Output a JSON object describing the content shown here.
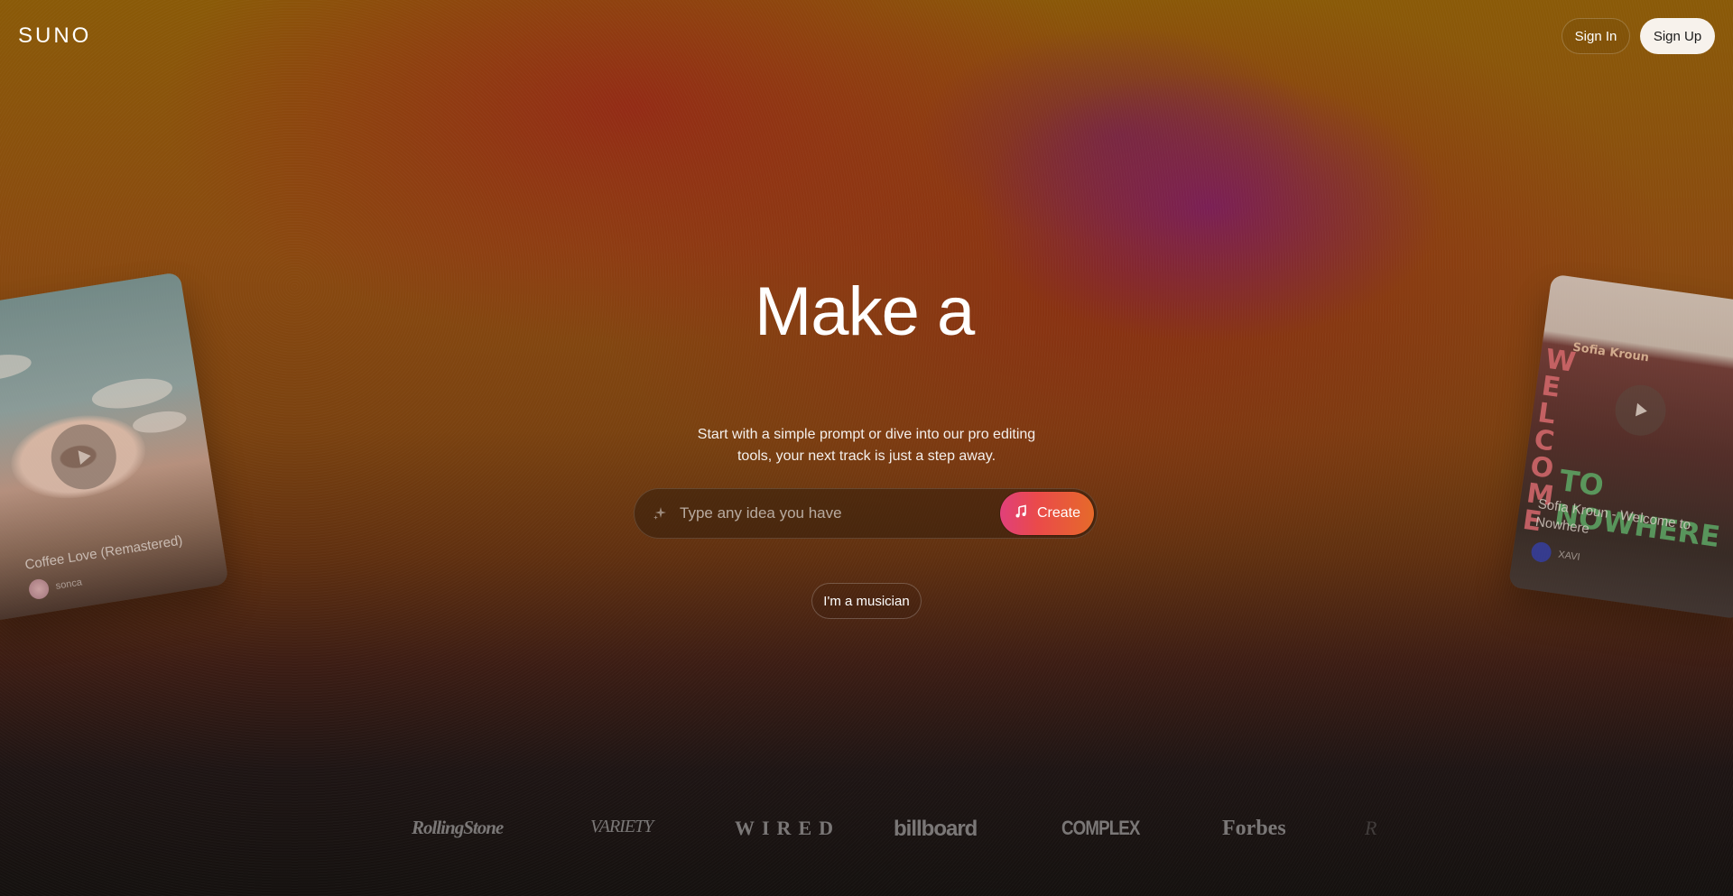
{
  "header": {
    "logo": "SUNO",
    "sign_in": "Sign In",
    "sign_up": "Sign Up"
  },
  "hero": {
    "headline": "Make a",
    "subtitle_line1": "Start with a simple prompt or dive into our pro editing",
    "subtitle_line2": "tools, your next track is just a step away.",
    "prompt_placeholder": "Type any idea you have",
    "create_label": "Create",
    "musician_label": "I'm a musician"
  },
  "cards": {
    "left": {
      "title": "Coffee Love (Remastered)",
      "user": "sonca"
    },
    "right": {
      "title_line1": "Sofia Kroun - Welcome to",
      "title_line2": "Nowhere",
      "user": "XAVI",
      "poster_top": "Sofia Kroun",
      "poster_side": "WELCOME",
      "poster_bottom": "TO NOWHERE"
    }
  },
  "press": [
    "RollingStone",
    "VARIETY",
    "WIRED",
    "billboard",
    "COMPLEX",
    "Forbes",
    "R"
  ],
  "colors": {
    "create_gradient_start": "#e0407a",
    "create_gradient_end": "#e66a2a",
    "sign_up_bg": "#f7f2ec"
  }
}
